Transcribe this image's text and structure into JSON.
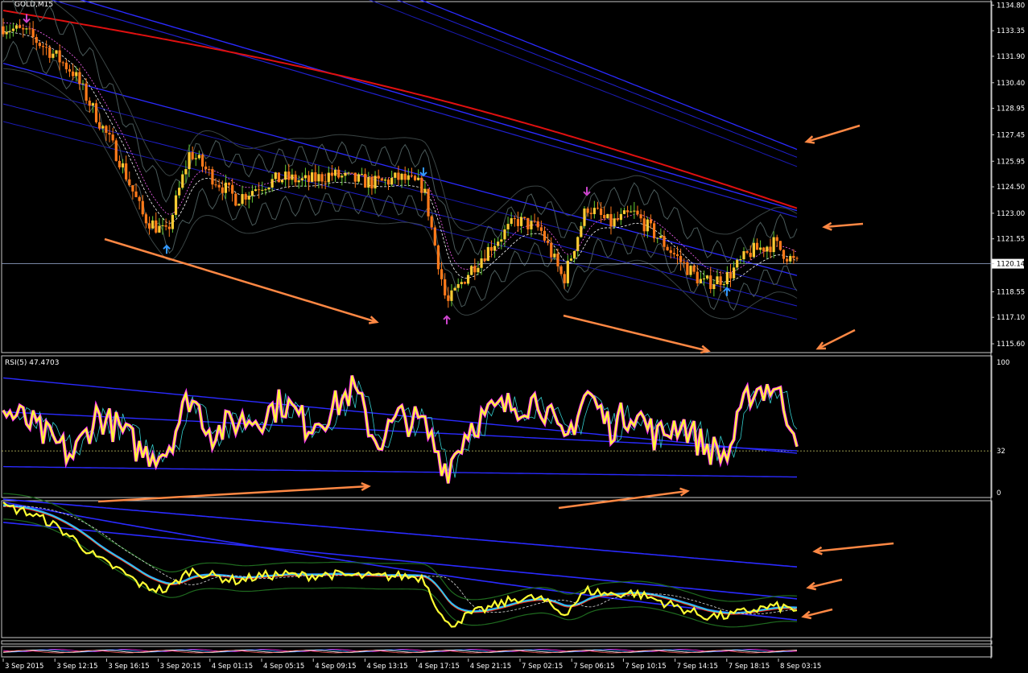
{
  "chart_data": [
    {
      "type": "candlestick",
      "title": "GOLD,M15",
      "y_ticks": [
        1134.8,
        1133.35,
        1131.9,
        1130.4,
        1128.95,
        1127.45,
        1125.95,
        1124.5,
        1123.0,
        1121.55,
        1120.14,
        1118.55,
        1117.1,
        1115.6
      ],
      "current_price": 1120.14,
      "ylim": [
        1115.1,
        1135.0
      ],
      "x_ticks": [
        "3 Sep 2015",
        "3 Sep 12:15",
        "3 Sep 16:15",
        "3 Sep 20:15",
        "4 Sep 01:15",
        "4 Sep 05:15",
        "4 Sep 09:15",
        "4 Sep 13:15",
        "4 Sep 17:15",
        "4 Sep 21:15",
        "7 Sep 02:15",
        "7 Sep 06:15",
        "7 Sep 10:15",
        "7 Sep 14:15",
        "7 Sep 18:15",
        "8 Sep 03:15"
      ],
      "close_path": [
        1133.6,
        1133.2,
        1132.2,
        1131.0,
        1128.5,
        1126.0,
        1122.8,
        1121.8,
        1126.5,
        1125.0,
        1123.8,
        1124.6,
        1125.0,
        1124.8,
        1125.2,
        1124.9,
        1124.7,
        1125.0,
        1124.5,
        1117.8,
        1119.8,
        1121.3,
        1122.6,
        1122.1,
        1119.2,
        1123.4,
        1122.4,
        1123.0,
        1121.7,
        1120.3,
        1119.0,
        1119.4,
        1120.8,
        1121.3,
        1120.1
      ],
      "arrows": [
        {
          "dir": "down",
          "color": "#cc44cc",
          "i": 1
        },
        {
          "dir": "up",
          "color": "#3399ff",
          "i": 7
        },
        {
          "dir": "down",
          "color": "#3399ff",
          "i": 18
        },
        {
          "dir": "up",
          "color": "#cc44cc",
          "i": 19
        },
        {
          "dir": "down",
          "color": "#cc44cc",
          "i": 25
        },
        {
          "dir": "up",
          "color": "#3399ff",
          "i": 31
        }
      ]
    },
    {
      "type": "line",
      "title": "RSI(5) 47.4703",
      "y_ticks": [
        100,
        32,
        0
      ],
      "ylim": [
        0,
        100
      ],
      "level": 32,
      "series": [
        {
          "values": [
            62,
            55,
            40,
            28,
            60,
            48,
            30,
            33,
            75,
            45,
            55,
            58,
            70,
            52,
            62,
            80,
            38,
            58,
            52,
            18,
            52,
            62,
            68,
            72,
            36,
            78,
            50,
            64,
            42,
            55,
            36,
            28,
            78,
            82,
            47
          ]
        }
      ]
    },
    {
      "type": "line",
      "series": [
        {
          "values": [
            1133.5,
            1132.8,
            1131.5,
            1129.5,
            1127.0,
            1125.5,
            1123.5,
            1123.0,
            1125.5,
            1124.8,
            1124.2,
            1124.8,
            1125.0,
            1124.8,
            1125.0,
            1124.8,
            1124.7,
            1124.8,
            1124.6,
            1118.5,
            1120.0,
            1121.0,
            1122.0,
            1122.0,
            1120.0,
            1123.0,
            1122.5,
            1122.7,
            1121.8,
            1120.8,
            1119.8,
            1119.8,
            1120.5,
            1121.0,
            1120.6
          ]
        }
      ]
    }
  ]
}
